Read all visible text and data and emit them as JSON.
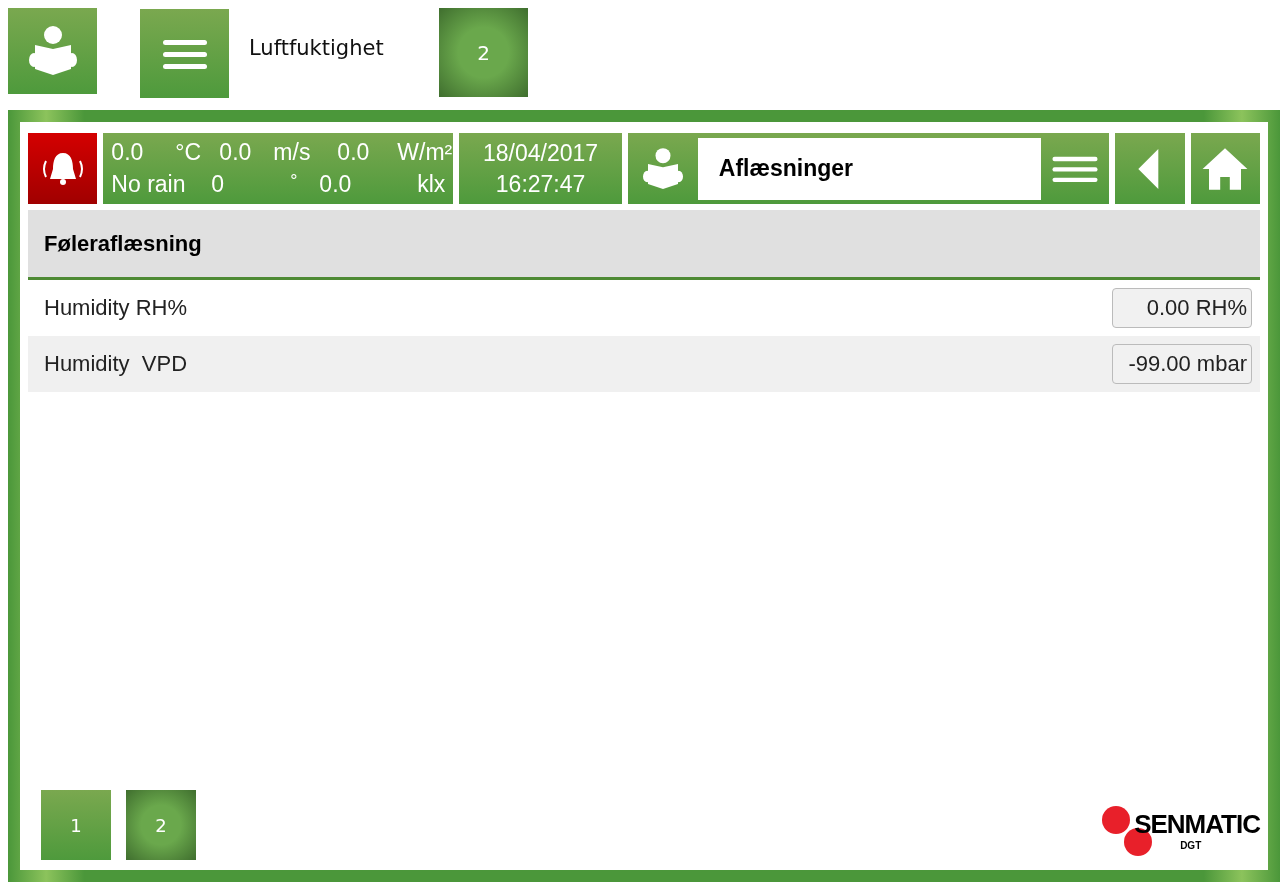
{
  "top_bar": {
    "title": "Luftfuktighet",
    "page": "2"
  },
  "header": {
    "alarm": {
      "active": true
    },
    "weather": [
      [
        "0.0",
        "°C",
        "0.0",
        "m/s",
        "0.0",
        "W/m²"
      ],
      [
        "No rain",
        "0",
        "°",
        "0.0",
        "klx"
      ]
    ],
    "date": "18/04/2017",
    "time": "16:27:47",
    "screen_title": "Aflæsninger"
  },
  "section": "Føleraflæsning",
  "readings": [
    {
      "label": "Humidity RH%",
      "value": "0.00 RH%"
    },
    {
      "label": "Humidity  VPD",
      "value": "-99.00 mbar"
    }
  ],
  "pages": [
    {
      "label": "1",
      "selected": false
    },
    {
      "label": "2",
      "selected": true
    }
  ],
  "logo": {
    "name": "SENMATIC",
    "sub": "DGT"
  }
}
